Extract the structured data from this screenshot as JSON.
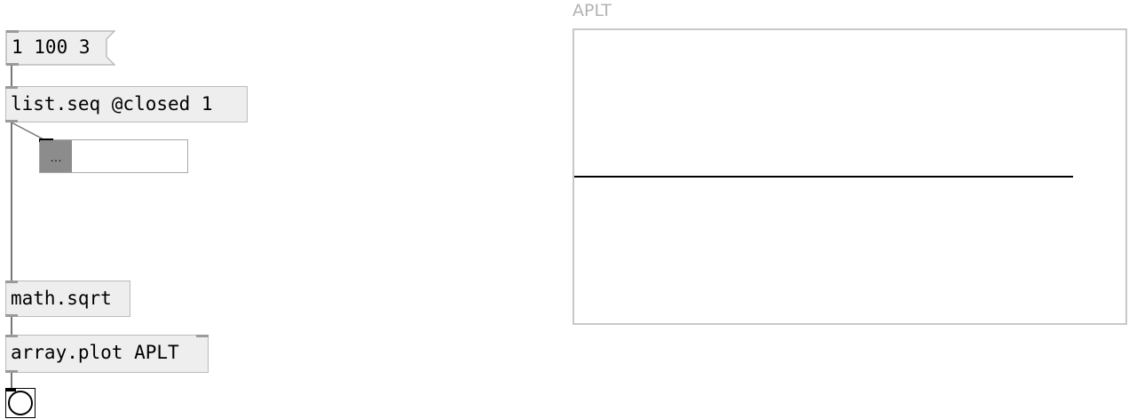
{
  "patch": {
    "message_box": {
      "text": "1 100 3"
    },
    "objects": {
      "list_seq": "list.seq @closed 1",
      "math_sqrt": "math.sqrt",
      "array_plot": "array.plot APLT"
    },
    "list_view": {
      "button_label": "..."
    },
    "array": {
      "name": "APLT",
      "line_level": 0.5
    }
  }
}
